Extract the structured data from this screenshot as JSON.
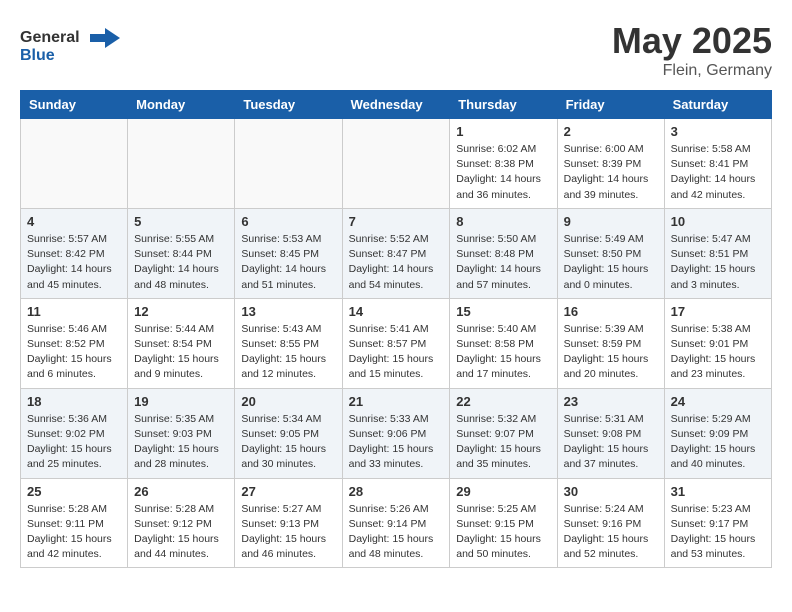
{
  "logo": {
    "text_general": "General",
    "text_blue": "Blue"
  },
  "title": "May 2025",
  "subtitle": "Flein, Germany",
  "days_of_week": [
    "Sunday",
    "Monday",
    "Tuesday",
    "Wednesday",
    "Thursday",
    "Friday",
    "Saturday"
  ],
  "weeks": [
    [
      {
        "day": "",
        "info": ""
      },
      {
        "day": "",
        "info": ""
      },
      {
        "day": "",
        "info": ""
      },
      {
        "day": "",
        "info": ""
      },
      {
        "day": "1",
        "info": "Sunrise: 6:02 AM\nSunset: 8:38 PM\nDaylight: 14 hours\nand 36 minutes."
      },
      {
        "day": "2",
        "info": "Sunrise: 6:00 AM\nSunset: 8:39 PM\nDaylight: 14 hours\nand 39 minutes."
      },
      {
        "day": "3",
        "info": "Sunrise: 5:58 AM\nSunset: 8:41 PM\nDaylight: 14 hours\nand 42 minutes."
      }
    ],
    [
      {
        "day": "4",
        "info": "Sunrise: 5:57 AM\nSunset: 8:42 PM\nDaylight: 14 hours\nand 45 minutes."
      },
      {
        "day": "5",
        "info": "Sunrise: 5:55 AM\nSunset: 8:44 PM\nDaylight: 14 hours\nand 48 minutes."
      },
      {
        "day": "6",
        "info": "Sunrise: 5:53 AM\nSunset: 8:45 PM\nDaylight: 14 hours\nand 51 minutes."
      },
      {
        "day": "7",
        "info": "Sunrise: 5:52 AM\nSunset: 8:47 PM\nDaylight: 14 hours\nand 54 minutes."
      },
      {
        "day": "8",
        "info": "Sunrise: 5:50 AM\nSunset: 8:48 PM\nDaylight: 14 hours\nand 57 minutes."
      },
      {
        "day": "9",
        "info": "Sunrise: 5:49 AM\nSunset: 8:50 PM\nDaylight: 15 hours\nand 0 minutes."
      },
      {
        "day": "10",
        "info": "Sunrise: 5:47 AM\nSunset: 8:51 PM\nDaylight: 15 hours\nand 3 minutes."
      }
    ],
    [
      {
        "day": "11",
        "info": "Sunrise: 5:46 AM\nSunset: 8:52 PM\nDaylight: 15 hours\nand 6 minutes."
      },
      {
        "day": "12",
        "info": "Sunrise: 5:44 AM\nSunset: 8:54 PM\nDaylight: 15 hours\nand 9 minutes."
      },
      {
        "day": "13",
        "info": "Sunrise: 5:43 AM\nSunset: 8:55 PM\nDaylight: 15 hours\nand 12 minutes."
      },
      {
        "day": "14",
        "info": "Sunrise: 5:41 AM\nSunset: 8:57 PM\nDaylight: 15 hours\nand 15 minutes."
      },
      {
        "day": "15",
        "info": "Sunrise: 5:40 AM\nSunset: 8:58 PM\nDaylight: 15 hours\nand 17 minutes."
      },
      {
        "day": "16",
        "info": "Sunrise: 5:39 AM\nSunset: 8:59 PM\nDaylight: 15 hours\nand 20 minutes."
      },
      {
        "day": "17",
        "info": "Sunrise: 5:38 AM\nSunset: 9:01 PM\nDaylight: 15 hours\nand 23 minutes."
      }
    ],
    [
      {
        "day": "18",
        "info": "Sunrise: 5:36 AM\nSunset: 9:02 PM\nDaylight: 15 hours\nand 25 minutes."
      },
      {
        "day": "19",
        "info": "Sunrise: 5:35 AM\nSunset: 9:03 PM\nDaylight: 15 hours\nand 28 minutes."
      },
      {
        "day": "20",
        "info": "Sunrise: 5:34 AM\nSunset: 9:05 PM\nDaylight: 15 hours\nand 30 minutes."
      },
      {
        "day": "21",
        "info": "Sunrise: 5:33 AM\nSunset: 9:06 PM\nDaylight: 15 hours\nand 33 minutes."
      },
      {
        "day": "22",
        "info": "Sunrise: 5:32 AM\nSunset: 9:07 PM\nDaylight: 15 hours\nand 35 minutes."
      },
      {
        "day": "23",
        "info": "Sunrise: 5:31 AM\nSunset: 9:08 PM\nDaylight: 15 hours\nand 37 minutes."
      },
      {
        "day": "24",
        "info": "Sunrise: 5:29 AM\nSunset: 9:09 PM\nDaylight: 15 hours\nand 40 minutes."
      }
    ],
    [
      {
        "day": "25",
        "info": "Sunrise: 5:28 AM\nSunset: 9:11 PM\nDaylight: 15 hours\nand 42 minutes."
      },
      {
        "day": "26",
        "info": "Sunrise: 5:28 AM\nSunset: 9:12 PM\nDaylight: 15 hours\nand 44 minutes."
      },
      {
        "day": "27",
        "info": "Sunrise: 5:27 AM\nSunset: 9:13 PM\nDaylight: 15 hours\nand 46 minutes."
      },
      {
        "day": "28",
        "info": "Sunrise: 5:26 AM\nSunset: 9:14 PM\nDaylight: 15 hours\nand 48 minutes."
      },
      {
        "day": "29",
        "info": "Sunrise: 5:25 AM\nSunset: 9:15 PM\nDaylight: 15 hours\nand 50 minutes."
      },
      {
        "day": "30",
        "info": "Sunrise: 5:24 AM\nSunset: 9:16 PM\nDaylight: 15 hours\nand 52 minutes."
      },
      {
        "day": "31",
        "info": "Sunrise: 5:23 AM\nSunset: 9:17 PM\nDaylight: 15 hours\nand 53 minutes."
      }
    ]
  ]
}
